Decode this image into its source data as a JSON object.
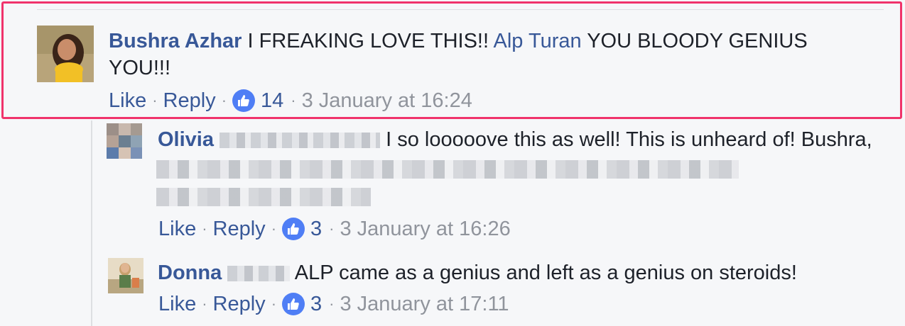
{
  "comments": [
    {
      "author": "Bushra Azhar",
      "text_before": "I FREAKING LOVE THIS!!",
      "mention": "Alp Turan",
      "text_after_line1": "YOU BLOODY GENIUS",
      "text_after_line2": "YOU!!!",
      "like_label": "Like",
      "reply_label": "Reply",
      "reactions": "14",
      "timestamp": "3 January at 16:24"
    },
    {
      "author": "Olivia",
      "text": "I so looooove this as well! This is unheard of! Bushra,",
      "like_label": "Like",
      "reply_label": "Reply",
      "reactions": "3",
      "timestamp": "3 January at 16:26"
    },
    {
      "author": "Donna",
      "text": "ALP came as a genius and left as a genius on steroids!",
      "like_label": "Like",
      "reply_label": "Reply",
      "reactions": "3",
      "timestamp": "3 January at 17:11"
    }
  ],
  "separator": "·",
  "colors": {
    "link": "#385898",
    "meta": "#90949c",
    "highlight": "#f0336b",
    "like_badge": "#4f7ef5"
  }
}
